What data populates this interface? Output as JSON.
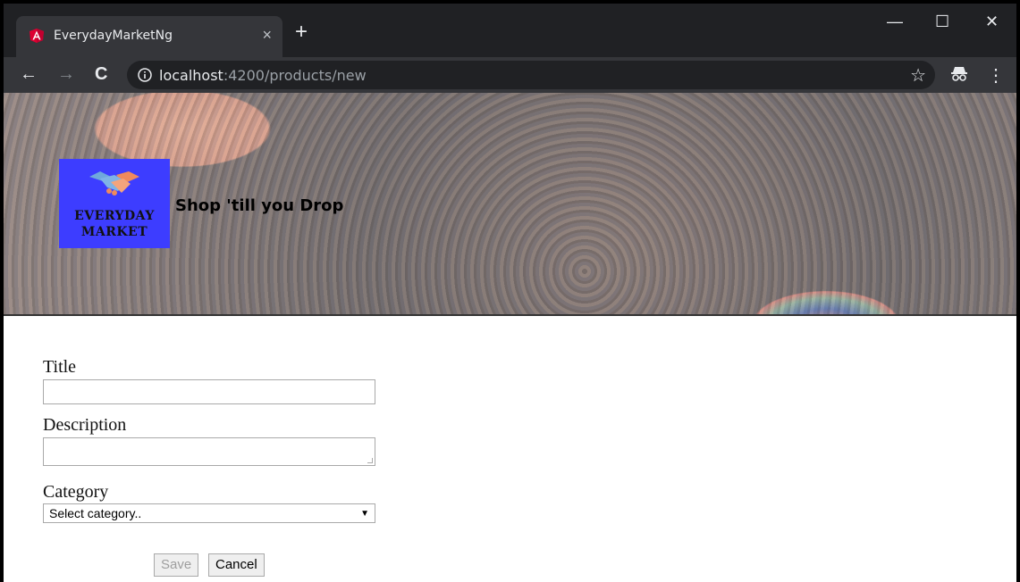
{
  "browser": {
    "tab_title": "EverydayMarketNg",
    "tab_close": "×",
    "new_tab": "+",
    "url_host": "localhost",
    "url_path": ":4200/products/new",
    "window_controls": {
      "minimize": "—",
      "maximize": "☐",
      "close": "✕"
    },
    "nav": {
      "back": "←",
      "forward": "→",
      "reload": "C"
    },
    "star": "☆",
    "menu": "⋮"
  },
  "banner": {
    "logo_line1": "EVERYDAY",
    "logo_line2": "MARKET",
    "tagline": "Shop 'till you Drop",
    "logo_bg": "#3d3dff"
  },
  "form": {
    "title_label": "Title",
    "title_value": "",
    "description_label": "Description",
    "description_value": "",
    "category_label": "Category",
    "category_selected": "Select category..",
    "save_label": "Save",
    "cancel_label": "Cancel"
  }
}
